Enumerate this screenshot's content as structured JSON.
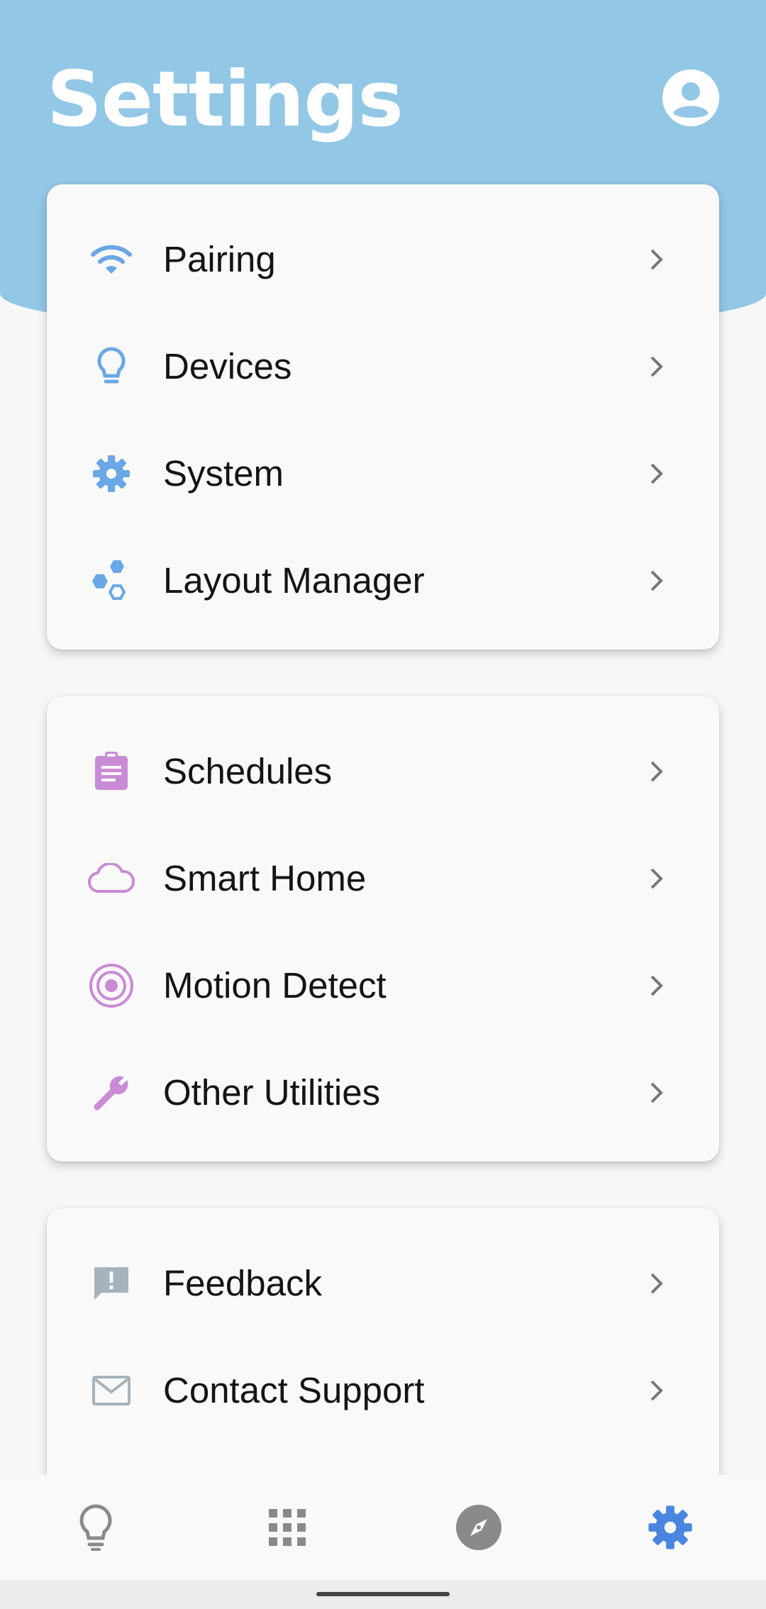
{
  "header": {
    "title": "Settings",
    "profile_icon": "account-circle-icon"
  },
  "colors": {
    "header": "#93c7e6",
    "blue_icon": "#6aa7e6",
    "purple_icon": "#c98bd5",
    "gray_icon": "#a6b3bd",
    "nav_active": "#4a86e0",
    "nav_inactive": "#8a8a8a"
  },
  "groups": [
    {
      "items": [
        {
          "label": "Pairing",
          "icon": "wifi-icon"
        },
        {
          "label": "Devices",
          "icon": "lightbulb-icon"
        },
        {
          "label": "System",
          "icon": "gear-icon"
        },
        {
          "label": "Layout Manager",
          "icon": "hexagons-icon"
        }
      ]
    },
    {
      "items": [
        {
          "label": "Schedules",
          "icon": "clipboard-icon"
        },
        {
          "label": "Smart Home",
          "icon": "cloud-icon"
        },
        {
          "label": "Motion Detect",
          "icon": "target-icon"
        },
        {
          "label": "Other Utilities",
          "icon": "wrench-icon"
        }
      ]
    },
    {
      "items": [
        {
          "label": "Feedback",
          "icon": "feedback-icon"
        },
        {
          "label": "Contact Support",
          "icon": "mail-icon"
        }
      ]
    }
  ],
  "bottom_nav": [
    {
      "icon": "lightbulb-icon",
      "active": false
    },
    {
      "icon": "grid-icon",
      "active": false
    },
    {
      "icon": "compass-icon",
      "active": false
    },
    {
      "icon": "gear-icon",
      "active": true
    }
  ]
}
